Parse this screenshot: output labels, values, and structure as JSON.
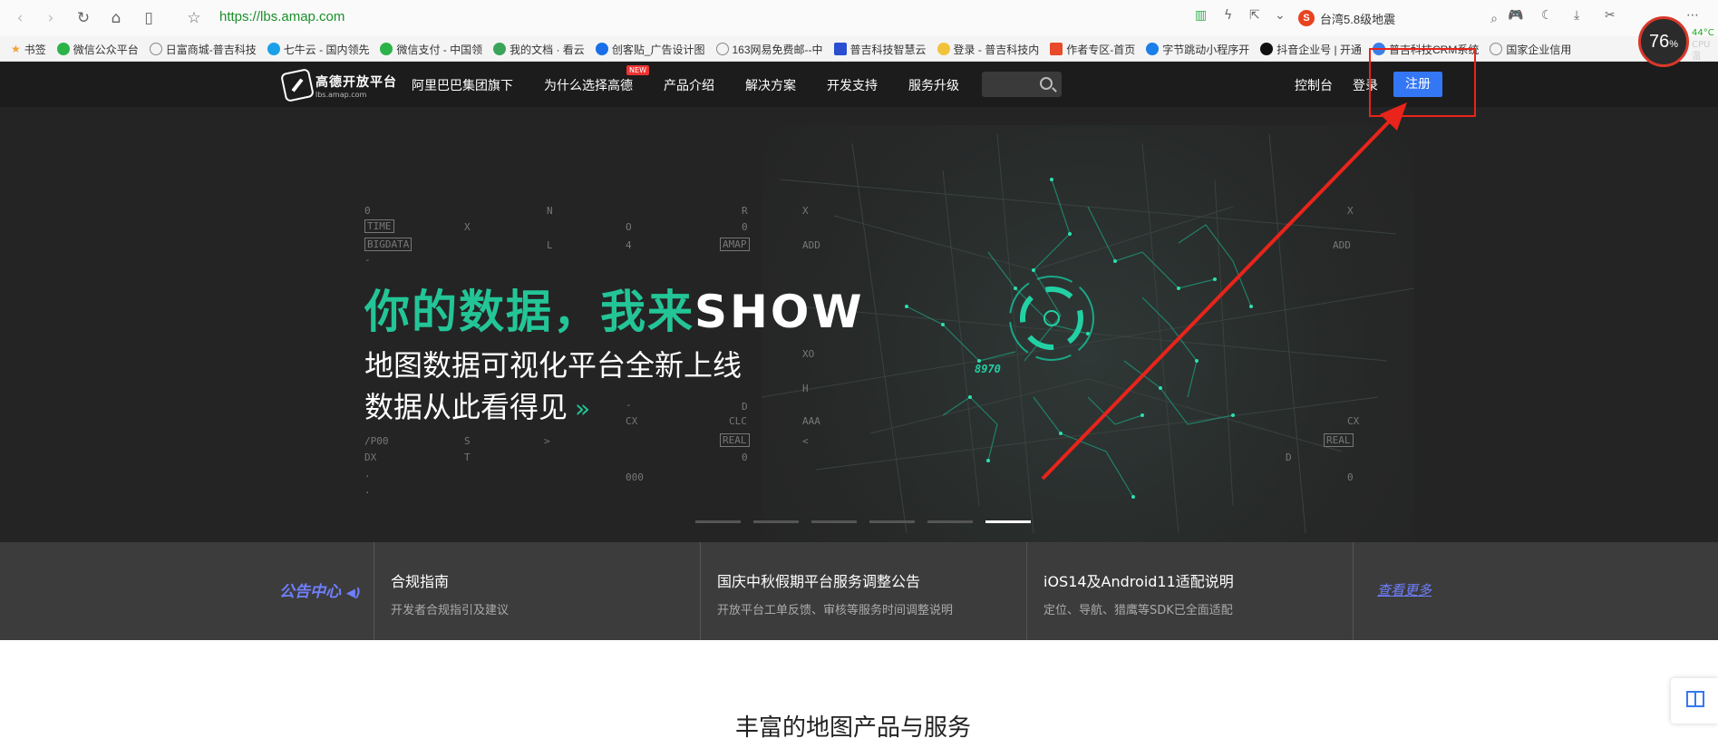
{
  "browser": {
    "url": "https://lbs.amap.com",
    "search_text": "台湾5.8级地震",
    "cpu_percent": "76",
    "cpu_unit": "%",
    "cpu_temp": "44°C",
    "cpu_label": "CPU温",
    "bookmarks": [
      {
        "label": "书签",
        "color": "#f2a23a"
      },
      {
        "label": "微信公众平台",
        "color": "#2bb34a"
      },
      {
        "label": "日富商城-普吉科技",
        "color": "#888888"
      },
      {
        "label": "七牛云 - 国内领先",
        "color": "#1aa0e8"
      },
      {
        "label": "微信支付 - 中国领",
        "color": "#2bb34a"
      },
      {
        "label": "我的文档 · 看云",
        "color": "#3aa55a"
      },
      {
        "label": "创客贴_广告设计图",
        "color": "#1a6fe8"
      },
      {
        "label": "163网易免费邮--中",
        "color": "#888888"
      },
      {
        "label": "普吉科技智慧云",
        "color": "#2a4fd0"
      },
      {
        "label": "登录 - 普吉科技内",
        "color": "#f2c33a"
      },
      {
        "label": "作者专区-首页",
        "color": "#e84a2a"
      },
      {
        "label": "字节跳动小程序开",
        "color": "#1a7fe8"
      },
      {
        "label": "抖音企业号 | 开通",
        "color": "#111111"
      },
      {
        "label": "普吉科技CRM系统",
        "color": "#3a7fe8"
      },
      {
        "label": "国家企业信用",
        "color": "#888888"
      }
    ]
  },
  "header": {
    "logo_cn": "高德开放平台",
    "logo_en": "lbs.amap.com",
    "nav": [
      "阿里巴巴集团旗下",
      "为什么选择高德",
      "产品介绍",
      "解决方案",
      "开发支持",
      "服务升级"
    ],
    "new_badge": "NEW",
    "console": "控制台",
    "login": "登录",
    "register": "注册"
  },
  "hero": {
    "headline": "你的数据，我来",
    "headline_show": "SHOW",
    "line1": "地图数据可视化平台全新上线",
    "line2": "数据从此看得见",
    "chevrons": "»",
    "map_number": "8970",
    "deco": {
      "zero1": "0",
      "time": "TIME",
      "bigdata": "BIGDATA",
      "dash1": "-",
      "n": "N",
      "x1": "X",
      "l": "L",
      "o": "O",
      "four": "4",
      "r": "R",
      "amap": "AMAP",
      "x2": "X",
      "add": "ADD",
      "x3": "X",
      "add2": "ADD",
      "xo": "XO",
      "h": "H",
      "dash2": "-",
      "d": "D",
      "cx": "CX",
      "clc": "CLC",
      "aaa": "AAA",
      "cx2": "CX",
      "real": "REAL",
      "real2": "REAL",
      "p00": "/P00",
      "s": "S",
      "dx": "DX",
      "t": "T",
      "zero2": "0",
      "zero3": "0",
      "d2": "D",
      "zero4": "0",
      "ooo": "000",
      "dot1": ".",
      "dot2": ".",
      "lt": "<",
      "gt": ">"
    },
    "slides": 6,
    "active_slide": 5
  },
  "notice": {
    "title": "公告中心",
    "items": [
      {
        "title": "合规指南",
        "desc": "开发者合规指引及建议"
      },
      {
        "title": "国庆中秋假期平台服务调整公告",
        "desc": "开放平台工单反馈、审核等服务时间调整说明"
      },
      {
        "title": "iOS14及Android11适配说明",
        "desc": "定位、导航、猎鹰等SDK已全面适配"
      }
    ],
    "more": "查看更多"
  },
  "section_title": "丰富的地图产品与服务",
  "colors": {
    "accent_green": "#23c597",
    "register_blue": "#3477f5",
    "annotation_red": "#e8241b",
    "notice_purple": "#6f7fff"
  }
}
